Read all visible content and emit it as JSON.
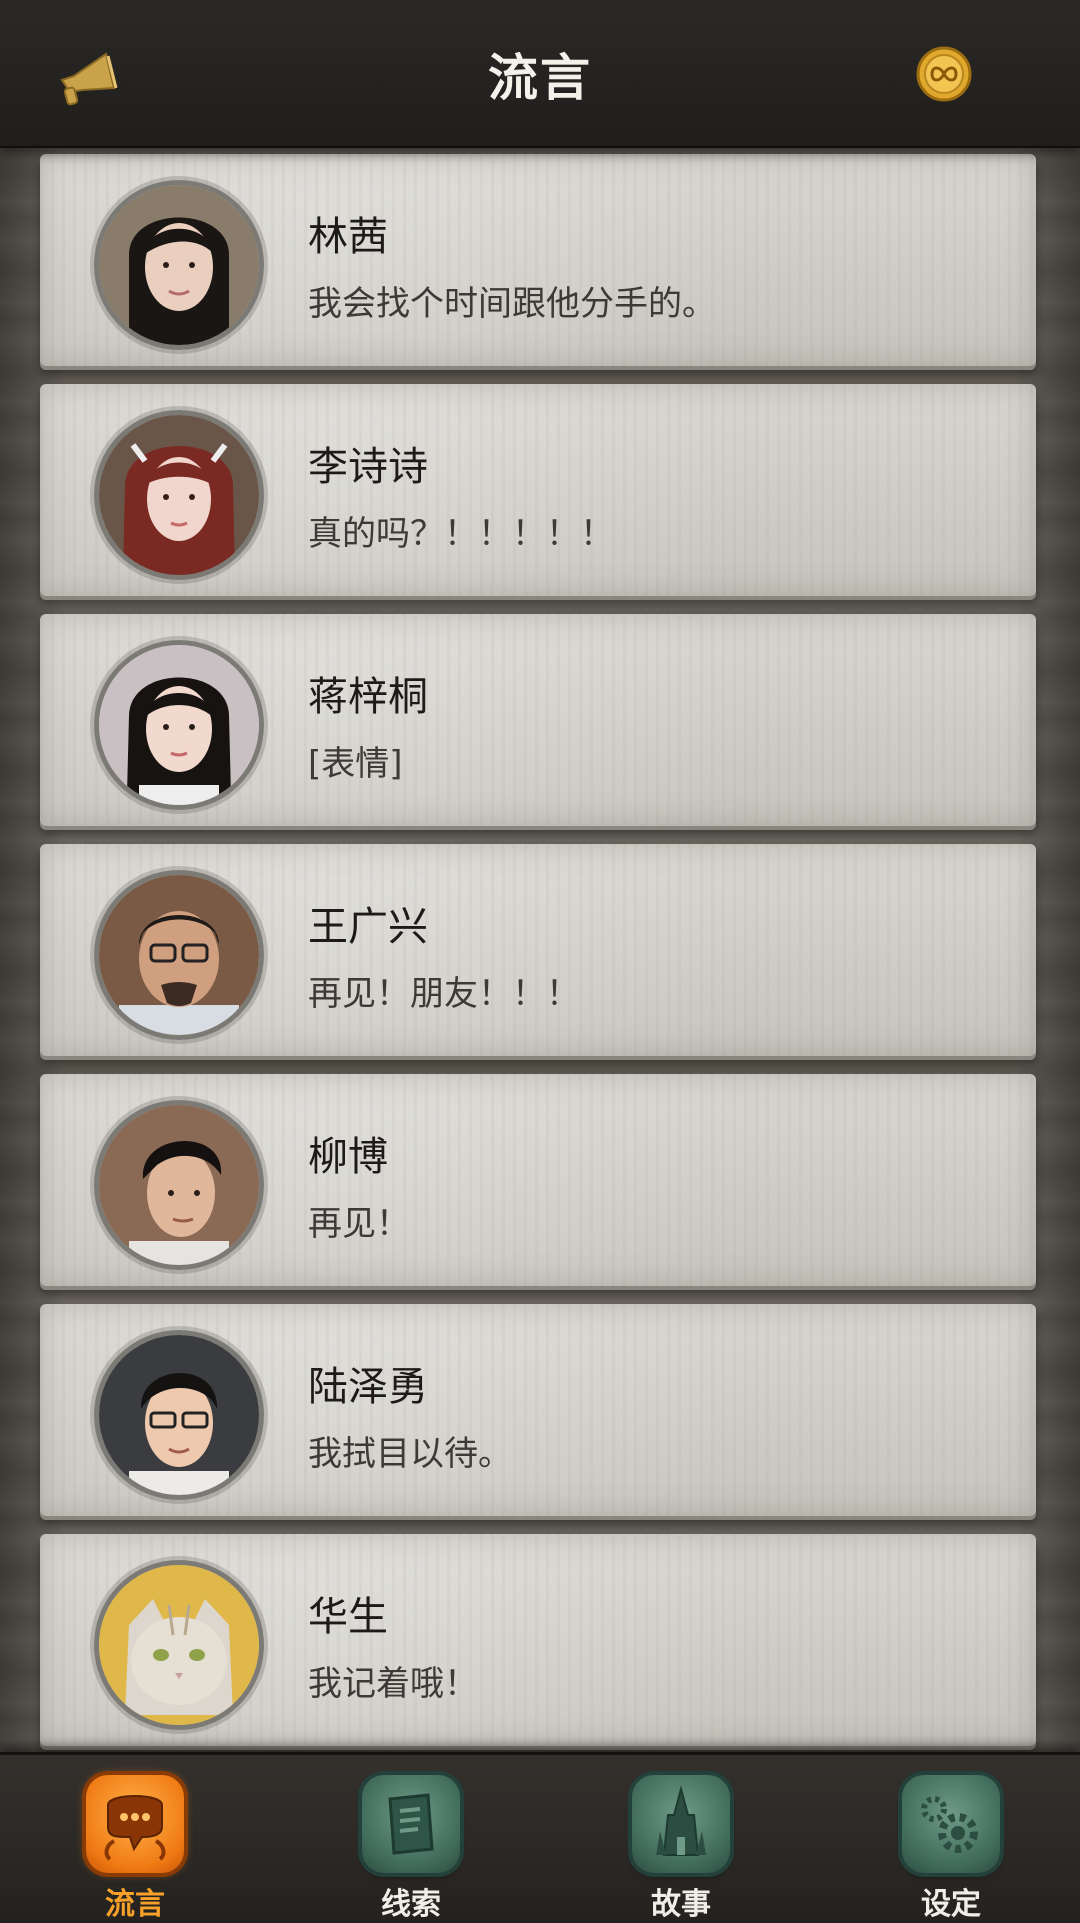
{
  "header": {
    "title": "流言",
    "left_icon": "megaphone-icon",
    "right_icon": "coin-infinity-icon"
  },
  "messages": [
    {
      "name": "林茜",
      "text": "我会找个时间跟他分手的。",
      "avatar": "avatar-woman-long-black-hair"
    },
    {
      "name": "李诗诗",
      "text": "真的吗？！！！！！",
      "avatar": "avatar-woman-auburn-hair"
    },
    {
      "name": "蒋梓桐",
      "text": "[表情]",
      "avatar": "avatar-woman-black-hair"
    },
    {
      "name": "王广兴",
      "text": "再见！朋友！！！",
      "avatar": "avatar-man-glasses-beard"
    },
    {
      "name": "柳博",
      "text": "再见！",
      "avatar": "avatar-man-slick-hair"
    },
    {
      "name": "陆泽勇",
      "text": "我拭目以待。",
      "avatar": "avatar-man-glasses"
    },
    {
      "name": "华生",
      "text": "我记着哦！",
      "avatar": "avatar-cat"
    }
  ],
  "nav": {
    "tabs": [
      {
        "label": "流言",
        "icon": "chat-bubble-icon",
        "active": true
      },
      {
        "label": "线索",
        "icon": "scroll-icon",
        "active": false
      },
      {
        "label": "故事",
        "icon": "castle-icon",
        "active": false
      },
      {
        "label": "设定",
        "icon": "gear-icon",
        "active": false
      }
    ]
  },
  "colors": {
    "active_tab": "#f7a12a",
    "header_bg": "#24221f",
    "card_bg": "#d4d2cc"
  }
}
